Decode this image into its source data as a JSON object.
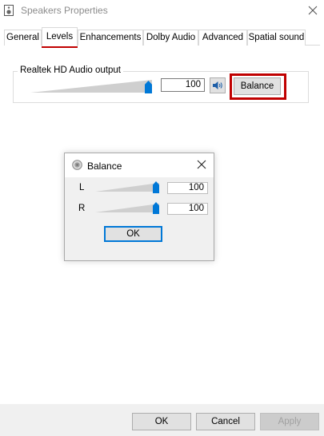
{
  "window": {
    "title": "Speakers Properties",
    "icon": "speaker-device-icon",
    "close_icon": "close-icon"
  },
  "tabs": [
    {
      "label": "General",
      "active": false
    },
    {
      "label": "Levels",
      "active": true
    },
    {
      "label": "Enhancements",
      "active": false
    },
    {
      "label": "Dolby Audio",
      "active": false
    },
    {
      "label": "Advanced",
      "active": false
    },
    {
      "label": "Spatial sound",
      "active": false
    }
  ],
  "levels": {
    "group_label": "Realtek HD Audio output",
    "volume_level": 100,
    "volume_text": "100",
    "mute_icon": "speaker-volume-icon",
    "balance_button": "Balance"
  },
  "balance_dialog": {
    "title": "Balance",
    "icon": "speaker-icon",
    "channels": [
      {
        "label": "L",
        "level": 100,
        "value": "100"
      },
      {
        "label": "R",
        "level": 100,
        "value": "100"
      }
    ],
    "ok_button": "OK"
  },
  "footer": {
    "ok": "OK",
    "cancel": "Cancel",
    "apply": "Apply"
  },
  "colors": {
    "highlight": "#c00000",
    "accent": "#0078d7"
  }
}
